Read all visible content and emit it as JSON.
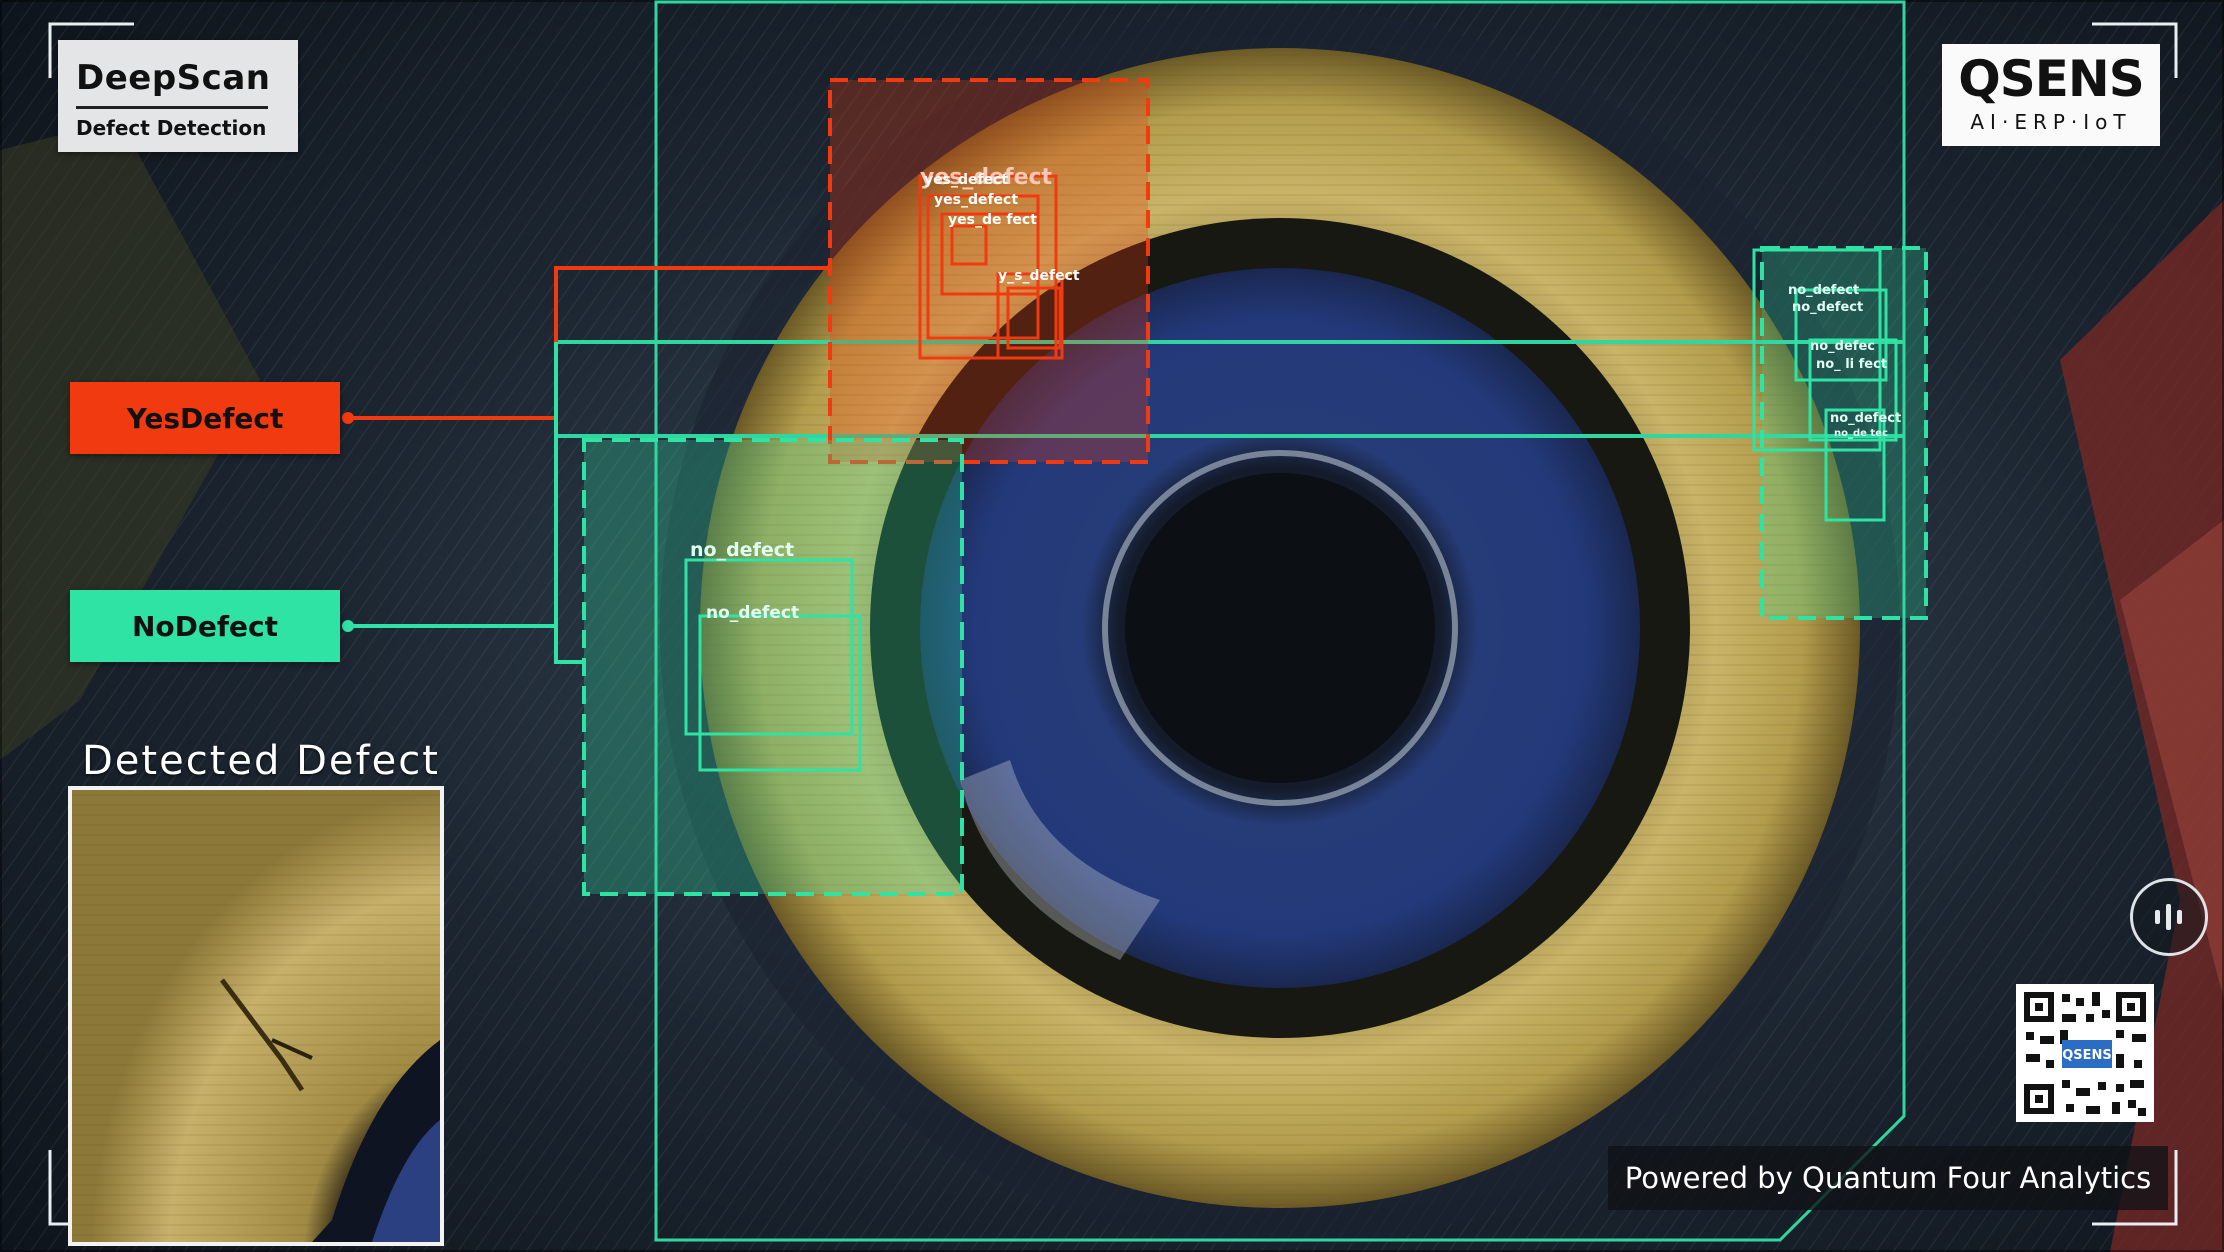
{
  "brand": {
    "title": "DeepScan",
    "subtitle": "Defect Detection"
  },
  "logo": {
    "name": "QSENS",
    "tagline": "AI·ERP·IoT"
  },
  "legend": {
    "yes_label": "YesDefect",
    "no_label": "NoDefect"
  },
  "detected_title": "Detected Defect",
  "detections": {
    "yes_tags": [
      "yes_defect",
      "yes_defect",
      "yes_defect",
      "yes_de fect",
      "y_s_defect"
    ],
    "no_tags_left": [
      "no_defect",
      "no_defect"
    ],
    "no_tags_right": [
      "no_defect",
      "no_defect",
      "no_defec",
      "no_ li fect",
      "no_defect",
      "no_de tec"
    ]
  },
  "footer": {
    "powered_by": "Powered by Quantum Four Analytics"
  },
  "colors": {
    "yes": "#f23a10",
    "no": "#2ee3a4",
    "frame": "#2fd6a0"
  },
  "icons": {
    "pause": "pause-icon",
    "qr": "qr-code-icon"
  }
}
